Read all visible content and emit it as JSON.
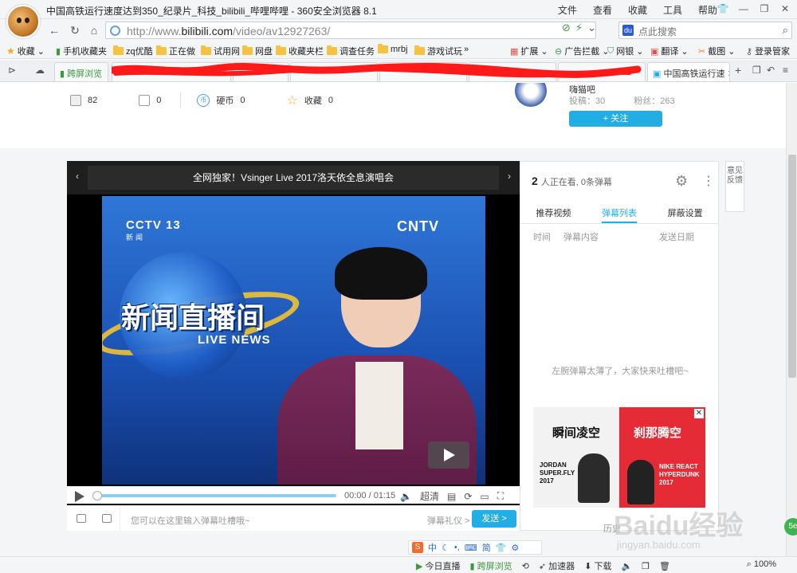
{
  "window": {
    "title": "中国高铁运行速度达到350_纪录片_科技_bilibili_哔哩哔哩 - 360安全浏览器 8.1",
    "menu": [
      "文件",
      "查看",
      "收藏",
      "工具",
      "帮助"
    ]
  },
  "address": {
    "url_prefix": "http://www.",
    "url_domain": "bilibili.com",
    "url_path": "/video/av12927263/",
    "search_placeholder": "点此搜索"
  },
  "bookmarks": {
    "items": [
      "收藏",
      "手机收藏夹",
      "zq优酷",
      "正在做",
      "试用网",
      "网盘",
      "收藏夹栏",
      "调查任务",
      "mrbj",
      "游戏试玩"
    ],
    "right_items": [
      "扩展",
      "广告拦截",
      "网银",
      "翻译",
      "截图",
      "登录管家"
    ]
  },
  "tabs": {
    "first": "跨屏浏览",
    "active": "中国高铁运行速"
  },
  "video_info": {
    "plays": "82",
    "danmaku_count": "0",
    "coin_label": "硬币",
    "coins": "0",
    "fav_label": "收藏",
    "favs": "0"
  },
  "uploader": {
    "name": "嗨猫吧",
    "submissions": "投稿：30",
    "fans": "粉丝：263",
    "follow_label": "+ 关注"
  },
  "player": {
    "title": "全网独家！Vsinger Live 2017洛天依全息演唱会",
    "overlay_channel": "CCTV 13",
    "overlay_channel_sub": "新闻",
    "overlay_cntv": "CNTV",
    "overlay_news_cn": "新闻直播间",
    "overlay_news_en": "LIVE NEWS",
    "time": "00:00 / 01:15",
    "quality": "超清",
    "danmaku_placeholder": "您可以在这里输入弹幕吐槽哦~",
    "etiquette": "弹幕礼仪 >",
    "send": "发送 >"
  },
  "side_panel": {
    "viewers_count": "2",
    "viewers_text": "人正在看, 0条弹幕",
    "tabs": [
      "推荐视频",
      "弹幕列表",
      "屏蔽设置"
    ],
    "headers": [
      "时间",
      "弹幕内容",
      "发送日期"
    ],
    "empty_message": "左腕弹幕太薄了，大家快来吐槽吧~",
    "history": "历史"
  },
  "ad": {
    "left_title": "瞬间凌空",
    "left_brand": "JORDAN SUPER.FLY 2017",
    "right_title": "刹那腾空",
    "right_brand": "NIKE REACT HYPERDUNK 2017"
  },
  "feedback": "意见反馈",
  "ime": [
    "中",
    "简"
  ],
  "statusbar": {
    "items": [
      "今日直播",
      "跨屏浏览",
      "加速器",
      "下载"
    ],
    "zoom": "100%"
  },
  "watermark": {
    "text": "Baidu经验",
    "url": "jingyan.baidu.com"
  }
}
